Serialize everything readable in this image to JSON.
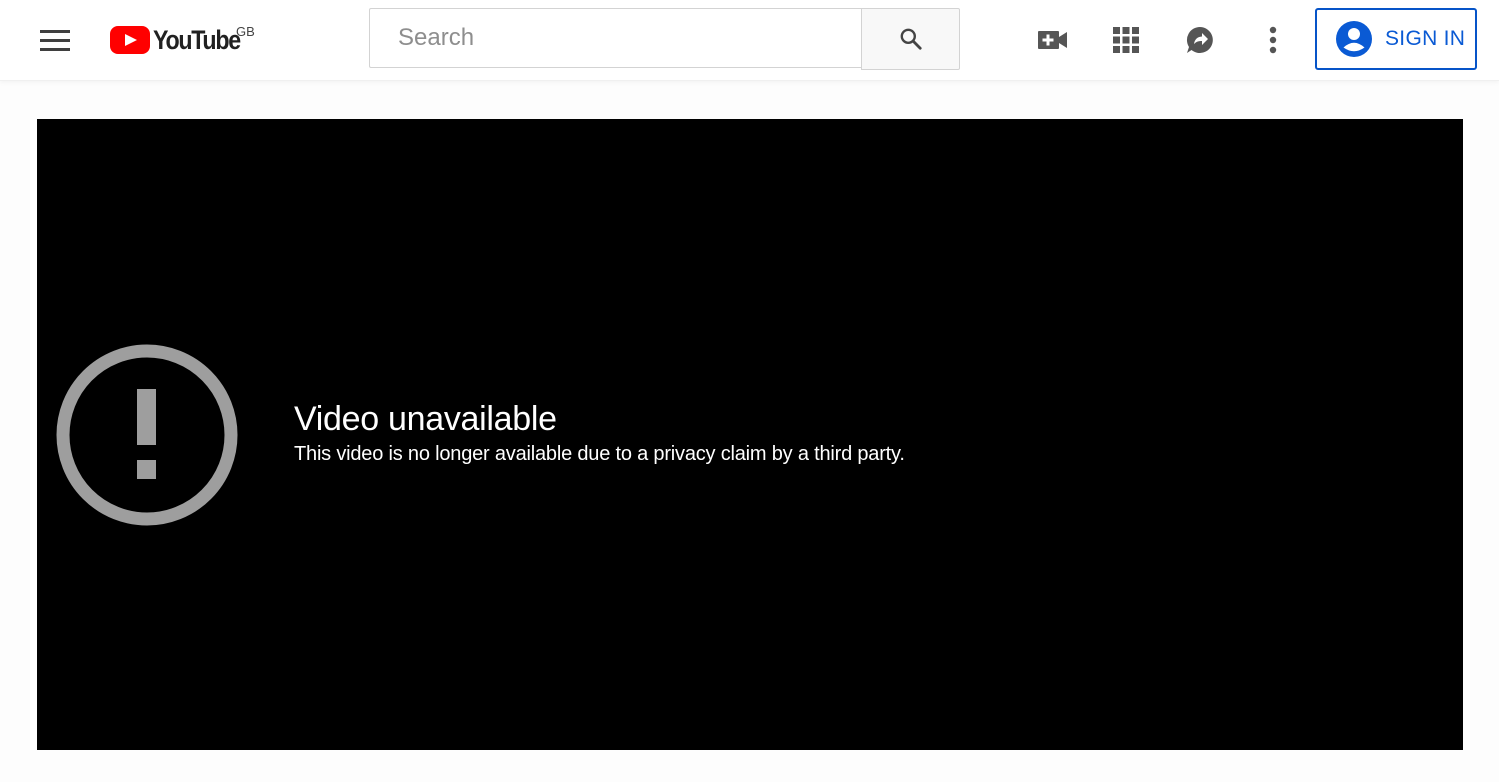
{
  "header": {
    "menu_icon": "hamburger-menu-icon",
    "logo": {
      "text": "YouTube",
      "region": "GB",
      "brand_color": "#ff0000"
    },
    "search": {
      "placeholder": "Search",
      "value": "",
      "button_icon": "search-icon"
    },
    "actions": [
      {
        "name": "create-video",
        "icon": "video-camera-plus-icon"
      },
      {
        "name": "apps",
        "icon": "apps-grid-icon"
      },
      {
        "name": "messages",
        "icon": "share-chat-icon"
      },
      {
        "name": "settings",
        "icon": "more-vert-icon"
      }
    ],
    "sign_in": {
      "label": "SIGN IN",
      "icon": "account-circle-icon",
      "color": "#0654c8"
    }
  },
  "player": {
    "background": "#000000",
    "error": {
      "icon": "alert-circle-icon",
      "icon_color": "#9e9e9e",
      "title": "Video unavailable",
      "subtitle": "This video is no longer available due to a privacy claim by a third party."
    }
  }
}
